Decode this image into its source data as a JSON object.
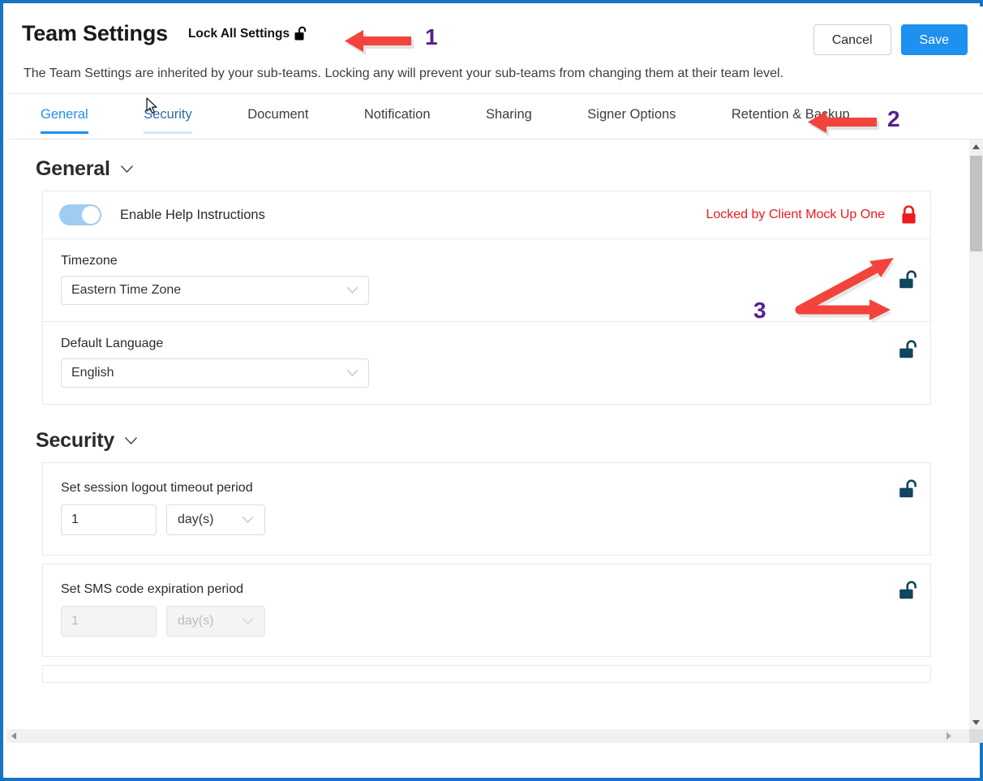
{
  "header": {
    "title": "Team Settings",
    "lock_all_label": "Lock All Settings",
    "lock_all_icon": "unlock-icon",
    "subtitle": "The Team Settings are inherited by your sub-teams. Locking any will prevent your sub-teams from changing them at their team level.",
    "cancel_label": "Cancel",
    "save_label": "Save",
    "save_color": "#1e90f0"
  },
  "tabs": [
    {
      "label": "General",
      "state": "active"
    },
    {
      "label": "Security",
      "state": "hovered"
    },
    {
      "label": "Document",
      "state": "normal"
    },
    {
      "label": "Notification",
      "state": "normal"
    },
    {
      "label": "Sharing",
      "state": "normal"
    },
    {
      "label": "Signer Options",
      "state": "normal"
    },
    {
      "label": "Retention & Backup",
      "state": "normal"
    }
  ],
  "sections": [
    {
      "title": "General",
      "caret_icon": "chevron-down-icon",
      "rows": [
        {
          "type": "toggle",
          "label": "Enable Help Instructions",
          "toggle_on": true,
          "locked": true,
          "locked_note": "Locked by Client Mock Up One",
          "locked_color": "#ea1c1c",
          "lock_icon": "lock-closed-icon"
        },
        {
          "type": "select",
          "label": "Timezone",
          "value": "Eastern Time Zone",
          "caret_icon": "chevron-down-icon",
          "locked": false,
          "lock_icon": "unlock-icon"
        },
        {
          "type": "select",
          "label": "Default Language",
          "value": "English",
          "caret_icon": "chevron-down-icon",
          "locked": false,
          "lock_icon": "unlock-icon"
        }
      ]
    },
    {
      "title": "Security",
      "caret_icon": "chevron-down-icon",
      "rows": [
        {
          "type": "number-unit",
          "label": "Set session logout timeout period",
          "number_value": "1",
          "unit_value": "day(s)",
          "caret_icon": "chevron-down-icon",
          "disabled": false,
          "locked": false,
          "lock_icon": "unlock-icon"
        },
        {
          "type": "number-unit",
          "label": "Set SMS code expiration period",
          "number_value": "1",
          "unit_value": "day(s)",
          "caret_icon": "chevron-down-icon",
          "disabled": true,
          "locked": false,
          "lock_icon": "unlock-icon"
        }
      ]
    }
  ],
  "annotations": [
    {
      "number": "1",
      "color": "#5b1d8c",
      "points_to": "lock-all-settings"
    },
    {
      "number": "2",
      "color": "#5b1d8c",
      "points_to": "tab-retention-backup"
    },
    {
      "number": "3",
      "color": "#5b1d8c",
      "points_to": "row-lock-icons"
    }
  ],
  "scrollbars": {
    "vertical_up_icon": "triangle-up-icon",
    "vertical_down_icon": "triangle-down-icon",
    "horizontal_left_icon": "triangle-left-icon",
    "horizontal_right_icon": "triangle-right-icon"
  },
  "cursor": {
    "icon": "mouse-pointer-icon"
  },
  "frame_color": "#1574c4"
}
